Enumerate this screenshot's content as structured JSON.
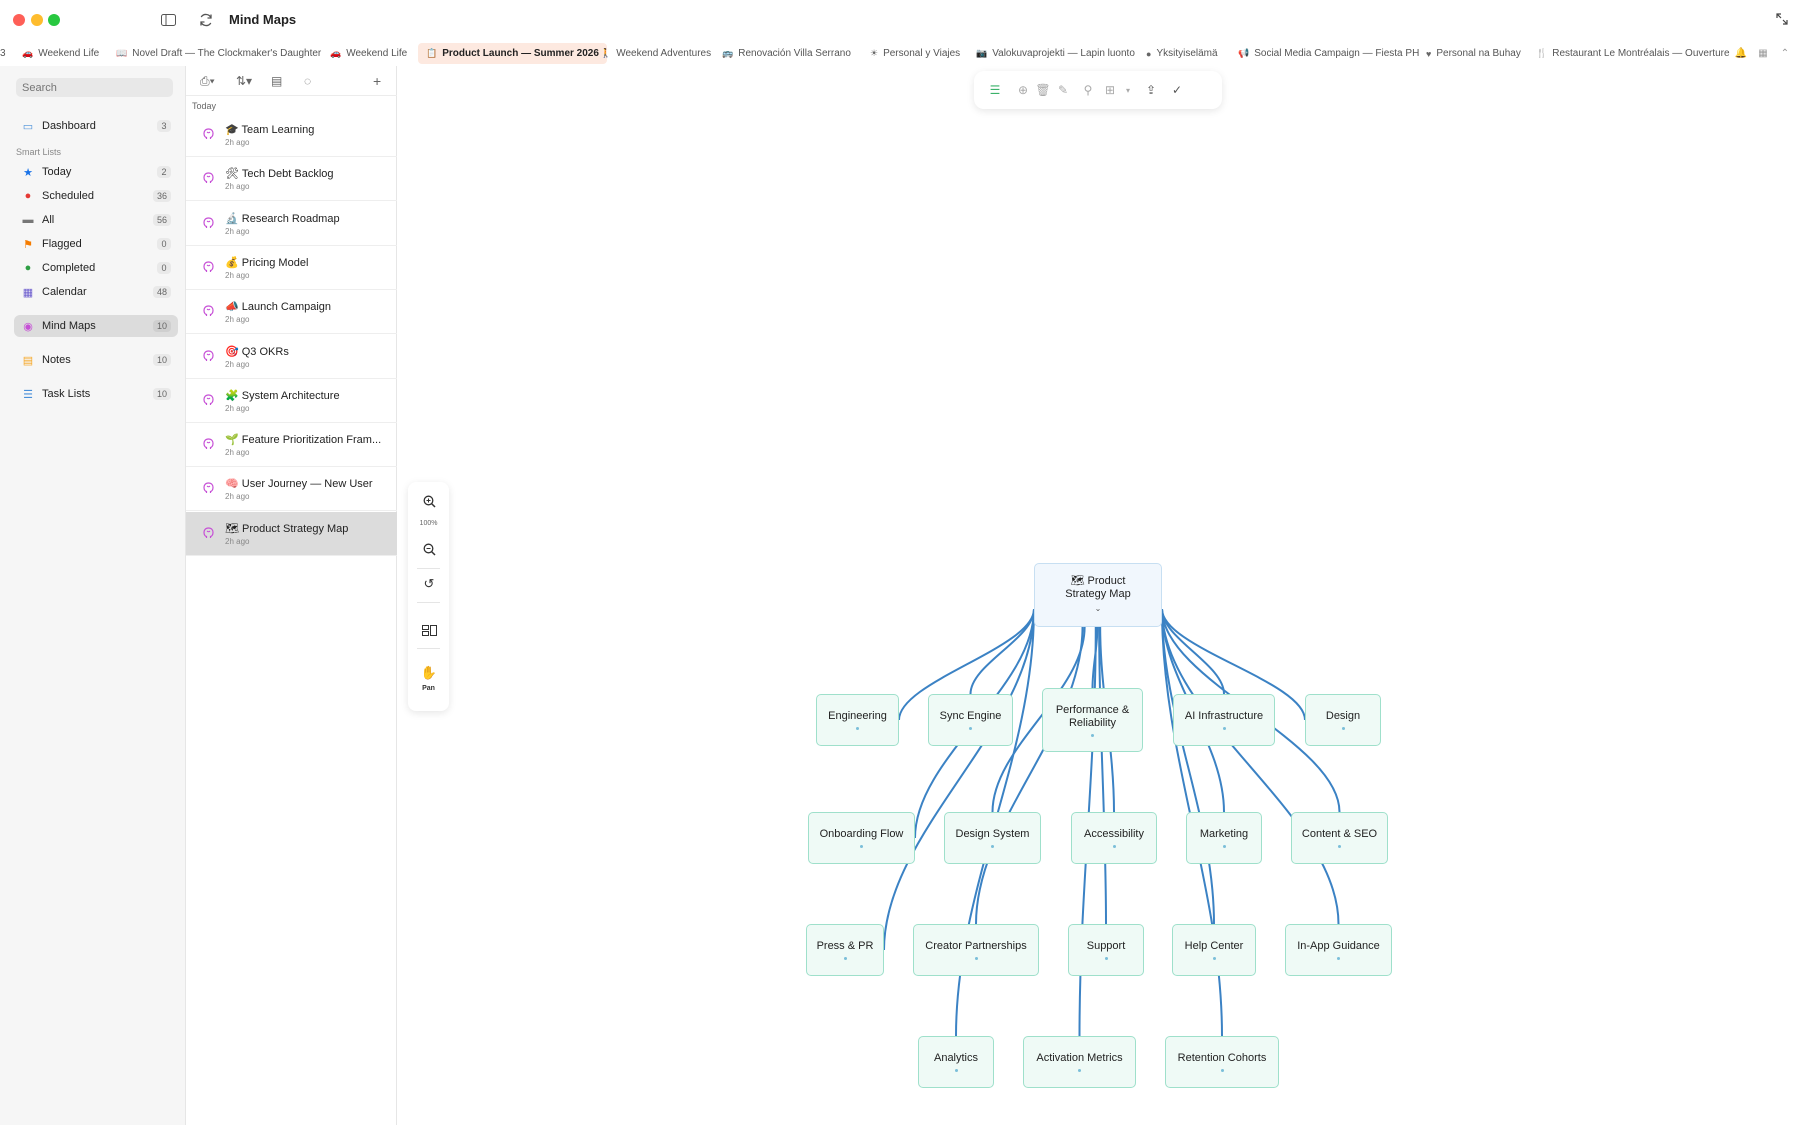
{
  "app": {
    "title": "Mind Maps"
  },
  "tabs": [
    {
      "label": "Weekend Life",
      "icon": "🚗",
      "active": false
    },
    {
      "label": "Novel Draft — The Clockmaker's Daughter",
      "icon": "📖",
      "active": false
    },
    {
      "label": "Weekend Life",
      "icon": "🚗",
      "active": false
    },
    {
      "label": "Product Launch — Summer 2026",
      "icon": "📋",
      "active": true
    },
    {
      "label": "Weekend Adventures",
      "icon": "🚶",
      "active": false
    },
    {
      "label": "Renovación Villa Serrano",
      "icon": "🚌",
      "active": false
    },
    {
      "label": "Personal y Viajes",
      "icon": "☀",
      "active": false
    },
    {
      "label": "Valokuvaprojekti — Lapin luonto",
      "icon": "📷",
      "active": false
    },
    {
      "label": "Yksityiselämä",
      "icon": "●",
      "active": false
    },
    {
      "label": "Social Media Campaign — Fiesta PH",
      "icon": "📢",
      "active": false
    },
    {
      "label": "Personal na Buhay",
      "icon": "♥",
      "active": false
    },
    {
      "label": "Restaurant Le Montréalais — Ouverture",
      "icon": "🍴",
      "active": false
    }
  ],
  "sidebar": {
    "search_placeholder": "Search",
    "smart_lists_heading": "Smart Lists",
    "items": [
      {
        "label": "Dashboard",
        "count": "3",
        "icon": "dashboard-icon",
        "color": "#4a90d9"
      },
      {
        "label": "Today",
        "count": "2",
        "icon": "star-icon",
        "color": "#1a73e8"
      },
      {
        "label": "Scheduled",
        "count": "36",
        "icon": "clock-icon",
        "color": "#e53935"
      },
      {
        "label": "All",
        "count": "56",
        "icon": "tray-icon",
        "color": "#777777"
      },
      {
        "label": "Flagged",
        "count": "0",
        "icon": "flag-icon",
        "color": "#f57c00"
      },
      {
        "label": "Completed",
        "count": "0",
        "icon": "check-circle-icon",
        "color": "#2e9e44"
      },
      {
        "label": "Calendar",
        "count": "48",
        "icon": "calendar-icon",
        "color": "#6a5acd"
      },
      {
        "label": "Mind Maps",
        "count": "10",
        "icon": "brain-icon",
        "color": "#c64fd6"
      },
      {
        "label": "Notes",
        "count": "10",
        "icon": "note-icon",
        "color": "#f5a623"
      },
      {
        "label": "Task Lists",
        "count": "10",
        "icon": "list-icon",
        "color": "#4a90d9"
      }
    ]
  },
  "list": {
    "group": "Today",
    "items": [
      {
        "emoji": "🎓",
        "title": "Team Learning",
        "sub": "2h ago"
      },
      {
        "emoji": "🛠",
        "title": "Tech Debt Backlog",
        "sub": "2h ago"
      },
      {
        "emoji": "🔬",
        "title": "Research Roadmap",
        "sub": "2h ago"
      },
      {
        "emoji": "💰",
        "title": "Pricing Model",
        "sub": "2h ago"
      },
      {
        "emoji": "📣",
        "title": "Launch Campaign",
        "sub": "2h ago"
      },
      {
        "emoji": "🎯",
        "title": "Q3 OKRs",
        "sub": "2h ago"
      },
      {
        "emoji": "🧩",
        "title": "System Architecture",
        "sub": "2h ago"
      },
      {
        "emoji": "🌱",
        "title": "Feature Prioritization Fram...",
        "sub": "2h ago"
      },
      {
        "emoji": "🧠",
        "title": "User Journey — New User",
        "sub": "2h ago"
      },
      {
        "emoji": "🗺",
        "title": "Product Strategy Map",
        "sub": "2h ago"
      }
    ]
  },
  "zoom": {
    "level": "100%",
    "pan_label": "Pan"
  },
  "mindmap": {
    "root": {
      "emoji": "🗺",
      "line1": "Product",
      "line2": "Strategy Map"
    },
    "nodes": [
      {
        "id": "engineering",
        "label": "Engineering"
      },
      {
        "id": "sync",
        "label": "Sync Engine"
      },
      {
        "id": "perf",
        "label": "Performance & Reliability"
      },
      {
        "id": "ai",
        "label": "AI Infrastructure"
      },
      {
        "id": "design",
        "label": "Design"
      },
      {
        "id": "onboarding",
        "label": "Onboarding Flow"
      },
      {
        "id": "designsys",
        "label": "Design System"
      },
      {
        "id": "a11y",
        "label": "Accessibility"
      },
      {
        "id": "marketing",
        "label": "Marketing"
      },
      {
        "id": "seo",
        "label": "Content & SEO"
      },
      {
        "id": "press",
        "label": "Press & PR"
      },
      {
        "id": "creator",
        "label": "Creator Partnerships"
      },
      {
        "id": "support",
        "label": "Support"
      },
      {
        "id": "help",
        "label": "Help Center"
      },
      {
        "id": "inapp",
        "label": "In-App Guidance"
      },
      {
        "id": "analytics",
        "label": "Analytics"
      },
      {
        "id": "activation",
        "label": "Activation Metrics"
      },
      {
        "id": "retention",
        "label": "Retention Cohorts"
      }
    ],
    "edge_color": "#3b82c4"
  }
}
